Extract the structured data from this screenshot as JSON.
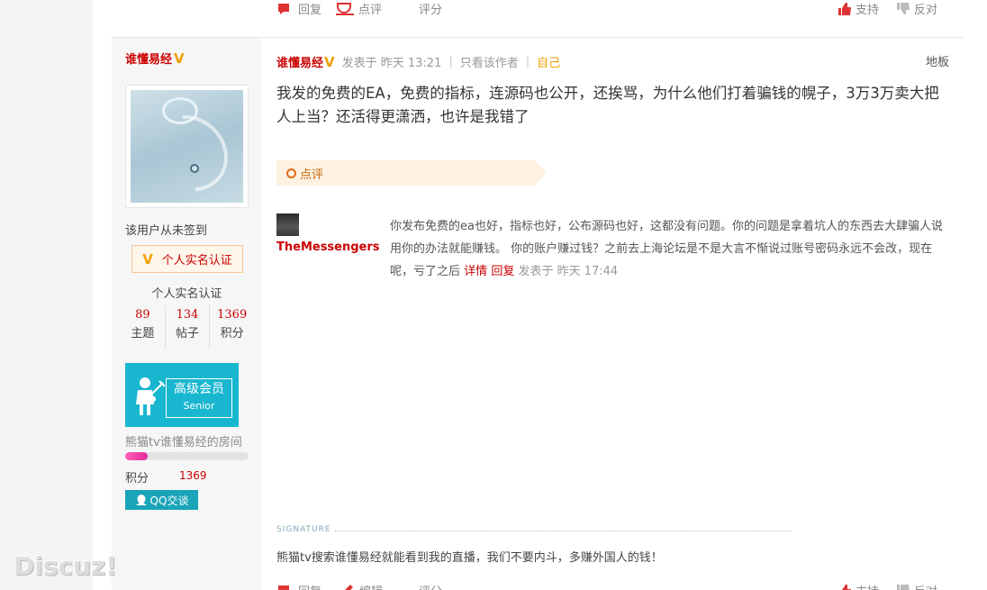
{
  "top_actions": {
    "reply": "回复",
    "comment": "点评",
    "rate": "评分",
    "support": "支持",
    "oppose": "反对"
  },
  "sidebar": {
    "author": "谁懂易经",
    "never_signed": "该用户从未签到",
    "verify_button": "个人实名认证",
    "verify_text": "个人实名认证",
    "stats": [
      {
        "num": "89",
        "label": "主题"
      },
      {
        "num": "134",
        "label": "帖子"
      },
      {
        "num": "1369",
        "label": "积分"
      }
    ],
    "member": {
      "title": "高级会员",
      "subtitle": "Senior"
    },
    "room_link": "熊猫tv谁懂易经的房间",
    "progress_fraction": 0.18,
    "points_label": "积分",
    "points_value": "1369",
    "qq_button": "QQ交谈"
  },
  "post": {
    "author": "谁懂易经",
    "posted_at": "发表于 昨天 13:21",
    "only_author": "只看该作者",
    "self_label": "自己",
    "floor": "地板",
    "body": "我发的免费的EA，免费的指标，连源码也公开，还挨骂，为什么他们打着骗钱的幌子，3万3万卖大把人上当？还活得更潇洒，也许是我错了",
    "comment_label": "点评"
  },
  "comment": {
    "user": "TheMessengers",
    "text": "你发布免费的ea也好，指标也好，公布源码也好，这都没有问题。你的问题是拿着坑人的东西去大肆骗人说用你的办法就能赚钱。 你的账户赚过钱？之前去上海论坛是不是大言不惭说过账号密码永远不会改，现在呢，亏了之后",
    "details": "详情",
    "reply": "回复",
    "time": "发表于 昨天 17:44"
  },
  "signature": {
    "label": "SIGNATURE",
    "text": "熊猫tv搜索谁懂易经就能看到我的直播，我们不要内斗，多赚外国人的钱！"
  },
  "bottom_actions": {
    "reply": "回复",
    "edit": "编辑",
    "rate": "评分",
    "support": "支持",
    "oppose": "反对"
  },
  "watermark": "Discuz!",
  "colors": {
    "accent_red": "#cc0000",
    "badge_teal": "#19b6cf",
    "vip_gold": "#f0a000"
  }
}
